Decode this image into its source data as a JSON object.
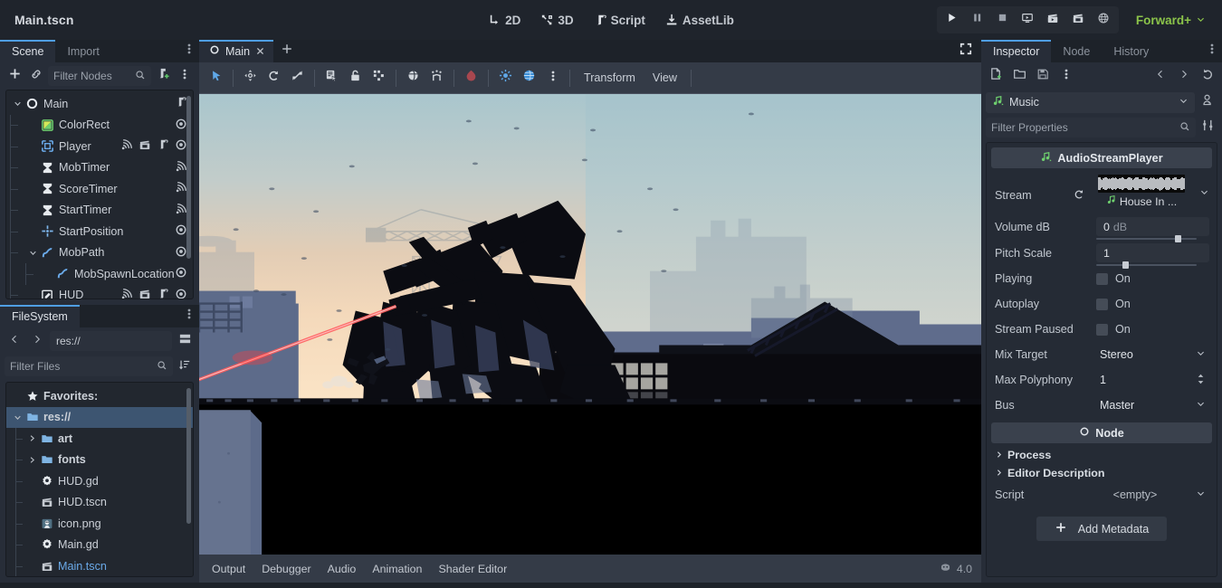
{
  "window": {
    "project_title": "Main.tscn"
  },
  "topbar": {
    "modes": [
      {
        "label": "2D",
        "icon": "2d-icon"
      },
      {
        "label": "3D",
        "icon": "3d-icon"
      },
      {
        "label": "Script",
        "icon": "script-icon"
      },
      {
        "label": "AssetLib",
        "icon": "assetlib-icon"
      }
    ],
    "play_controls": [
      {
        "name": "play-project-button",
        "icon": "play-icon"
      },
      {
        "name": "pause-project-button",
        "icon": "pause-icon"
      },
      {
        "name": "stop-project-button",
        "icon": "stop-icon"
      },
      {
        "name": "run-current-scene-button",
        "icon": "run-scene-icon"
      },
      {
        "name": "play-custom-scene-button",
        "icon": "movie-play-icon"
      },
      {
        "name": "play-specific-scene-button",
        "icon": "movie-icon"
      },
      {
        "name": "remote-debug-button",
        "icon": "globe-debug-icon"
      }
    ],
    "renderer": {
      "label": "Forward+",
      "color": "#8bc34a"
    }
  },
  "scene_dock": {
    "tabs": [
      {
        "label": "Scene",
        "active": true
      },
      {
        "label": "Import",
        "active": false
      }
    ],
    "toolbar": {
      "add_node": "plus-icon",
      "instantiate": "link-icon",
      "filter_placeholder": "Filter Nodes",
      "search_icon": "search-icon",
      "attach_script": "attach-script-icon",
      "more": "vertical-dots-icon"
    },
    "nodes": [
      {
        "label": "Main",
        "depth": 0,
        "icon": "node2d-circle-icon",
        "arrow": "down",
        "trailing": [
          "script-icon"
        ]
      },
      {
        "label": "ColorRect",
        "depth": 1,
        "icon": "colorrect-icon",
        "arrow": "",
        "trailing": [
          "visibility-icon"
        ]
      },
      {
        "label": "Player",
        "depth": 1,
        "icon": "area2d-icon",
        "arrow": "",
        "trailing": [
          "signal-icon",
          "anim-icon",
          "script-icon",
          "visibility-icon"
        ]
      },
      {
        "label": "MobTimer",
        "depth": 1,
        "icon": "timer-icon",
        "arrow": "",
        "trailing": [
          "signal-icon"
        ]
      },
      {
        "label": "ScoreTimer",
        "depth": 1,
        "icon": "timer-icon",
        "arrow": "",
        "trailing": [
          "signal-icon"
        ]
      },
      {
        "label": "StartTimer",
        "depth": 1,
        "icon": "timer-icon",
        "arrow": "",
        "trailing": [
          "signal-icon"
        ]
      },
      {
        "label": "StartPosition",
        "depth": 1,
        "icon": "marker2d-icon",
        "arrow": "",
        "trailing": [
          "visibility-icon"
        ]
      },
      {
        "label": "MobPath",
        "depth": 1,
        "icon": "path2d-icon",
        "arrow": "down",
        "trailing": [
          "visibility-icon"
        ]
      },
      {
        "label": "MobSpawnLocation",
        "depth": 2,
        "icon": "pathfollow2d-icon",
        "arrow": "",
        "trailing": [
          "visibility-icon"
        ]
      },
      {
        "label": "HUD",
        "depth": 1,
        "icon": "canvaslayer-icon",
        "arrow": "",
        "trailing": [
          "signal-icon",
          "anim-icon",
          "script-icon",
          "visibility-icon"
        ]
      }
    ]
  },
  "filesystem_dock": {
    "tabs": [
      {
        "label": "FileSystem",
        "active": true
      }
    ],
    "nav": {
      "back": "chevron-left-icon",
      "forward": "chevron-right-icon",
      "path": "res://",
      "toggle_split": "split-mode-icon"
    },
    "filter": {
      "placeholder": "Filter Files",
      "search_icon": "search-icon",
      "sort_icon": "sort-icon"
    },
    "items": [
      {
        "label": "Favorites:",
        "depth": 0,
        "icon": "star-icon",
        "arrow": "",
        "selected": false,
        "kind": "header"
      },
      {
        "label": "res://",
        "depth": 0,
        "icon": "folder-icon",
        "arrow": "down",
        "selected": true,
        "kind": "folder"
      },
      {
        "label": "art",
        "depth": 1,
        "icon": "folder-icon",
        "arrow": "right",
        "selected": false,
        "kind": "folder"
      },
      {
        "label": "fonts",
        "depth": 1,
        "icon": "folder-icon",
        "arrow": "right",
        "selected": false,
        "kind": "folder"
      },
      {
        "label": "HUD.gd",
        "depth": 1,
        "icon": "gdscript-icon",
        "arrow": "",
        "selected": false,
        "kind": "script"
      },
      {
        "label": "HUD.tscn",
        "depth": 1,
        "icon": "scene-icon",
        "arrow": "",
        "selected": false,
        "kind": "scene"
      },
      {
        "label": "icon.png",
        "depth": 1,
        "icon": "image-icon",
        "arrow": "",
        "selected": false,
        "kind": "image"
      },
      {
        "label": "Main.gd",
        "depth": 1,
        "icon": "gdscript-icon",
        "arrow": "",
        "selected": false,
        "kind": "script"
      },
      {
        "label": "Main.tscn",
        "depth": 1,
        "icon": "scene-icon",
        "arrow": "",
        "selected": false,
        "kind": "scene-open"
      }
    ]
  },
  "viewport": {
    "tab": {
      "label": "Main",
      "icon": "node2d-circle-icon",
      "close_icon": "close-icon"
    },
    "add_tab_icon": "plus-icon",
    "expand_icon": "expand-icon",
    "toolbar_tools": [
      {
        "name": "select-mode-tool",
        "icon": "cursor-icon"
      },
      {
        "name": "move-mode-tool",
        "icon": "move-icon"
      },
      {
        "name": "rotate-mode-tool",
        "icon": "rotate-icon"
      },
      {
        "name": "scale-mode-tool",
        "icon": "scale-icon"
      },
      {
        "name": "list-select-tool",
        "icon": "list-select-icon"
      },
      {
        "name": "lock-tool",
        "icon": "lock-icon"
      },
      {
        "name": "group-tool",
        "icon": "group-icon"
      },
      {
        "name": "skeleton-tool",
        "icon": "skeleton-icon"
      },
      {
        "name": "snap-tool",
        "icon": "snap-icon"
      },
      {
        "name": "ruler-tool",
        "icon": "ruler-icon"
      },
      {
        "name": "lights-preview-tool",
        "icon": "light-icon"
      },
      {
        "name": "grid-toggle-tool",
        "icon": "grid-globe-icon"
      },
      {
        "name": "viewport-options",
        "icon": "vertical-dots-icon"
      }
    ],
    "menus": [
      {
        "label": "Transform"
      },
      {
        "label": "View"
      }
    ],
    "bottom_tabs": [
      {
        "label": "Output"
      },
      {
        "label": "Debugger"
      },
      {
        "label": "Audio"
      },
      {
        "label": "Animation"
      },
      {
        "label": "Shader Editor"
      }
    ],
    "version": "4.0",
    "version_icon": "godot-logo-icon"
  },
  "inspector": {
    "tabs": [
      {
        "label": "Inspector",
        "active": true
      },
      {
        "label": "Node",
        "active": false
      },
      {
        "label": "History",
        "active": false
      }
    ],
    "toolbar": {
      "new_resource": "new-resource-icon",
      "load": "folder-open-icon",
      "save": "save-icon",
      "more": "vertical-dots-icon",
      "prev": "chevron-left-icon",
      "next": "chevron-right-icon",
      "history": "history-icon"
    },
    "selected_object": {
      "label": "Music",
      "icon": "audiostreamplayer-icon"
    },
    "side_buttons": {
      "open_docs": "open-docs-icon",
      "tools": "tools-icon"
    },
    "filter": {
      "placeholder": "Filter Properties",
      "search_icon": "search-icon"
    },
    "category": {
      "label": "AudioStreamPlayer",
      "icon": "audiostreamplayer-icon"
    },
    "properties": [
      {
        "name": "stream",
        "label": "Stream",
        "type": "resource",
        "value": "House In ...",
        "revert_icon": "revert-icon"
      },
      {
        "name": "volume-db",
        "label": "Volume dB",
        "type": "number-slider",
        "value": "0",
        "unit": "dB",
        "knob_pct": 78
      },
      {
        "name": "pitch-scale",
        "label": "Pitch Scale",
        "type": "number-slider",
        "value": "1",
        "unit": "",
        "knob_pct": 26
      },
      {
        "name": "playing",
        "label": "Playing",
        "type": "checkbox",
        "value": "On",
        "checked": false
      },
      {
        "name": "autoplay",
        "label": "Autoplay",
        "type": "checkbox",
        "value": "On",
        "checked": false
      },
      {
        "name": "stream-paused",
        "label": "Stream Paused",
        "type": "checkbox",
        "value": "On",
        "checked": false
      },
      {
        "name": "mix-target",
        "label": "Mix Target",
        "type": "dropdown",
        "value": "Stereo"
      },
      {
        "name": "max-polyphony",
        "label": "Max Polyphony",
        "type": "spinbox",
        "value": "1"
      },
      {
        "name": "bus",
        "label": "Bus",
        "type": "dropdown",
        "value": "Master"
      }
    ],
    "node_category": {
      "label": "Node",
      "icon": "node-circle-icon"
    },
    "sub_categories": [
      {
        "label": "Process"
      },
      {
        "label": "Editor Description"
      }
    ],
    "script_property": {
      "label": "Script",
      "value": "<empty>"
    },
    "add_metadata": {
      "label": "Add Metadata",
      "icon": "plus-icon"
    }
  },
  "colors": {
    "accent": "#4f9ee3",
    "renderer_green": "#8bc34a",
    "selection_blue": "#3d5571",
    "panel_bg": "#272d38",
    "toolbar_bg": "#343b47",
    "laser_red": "#e8313c"
  }
}
